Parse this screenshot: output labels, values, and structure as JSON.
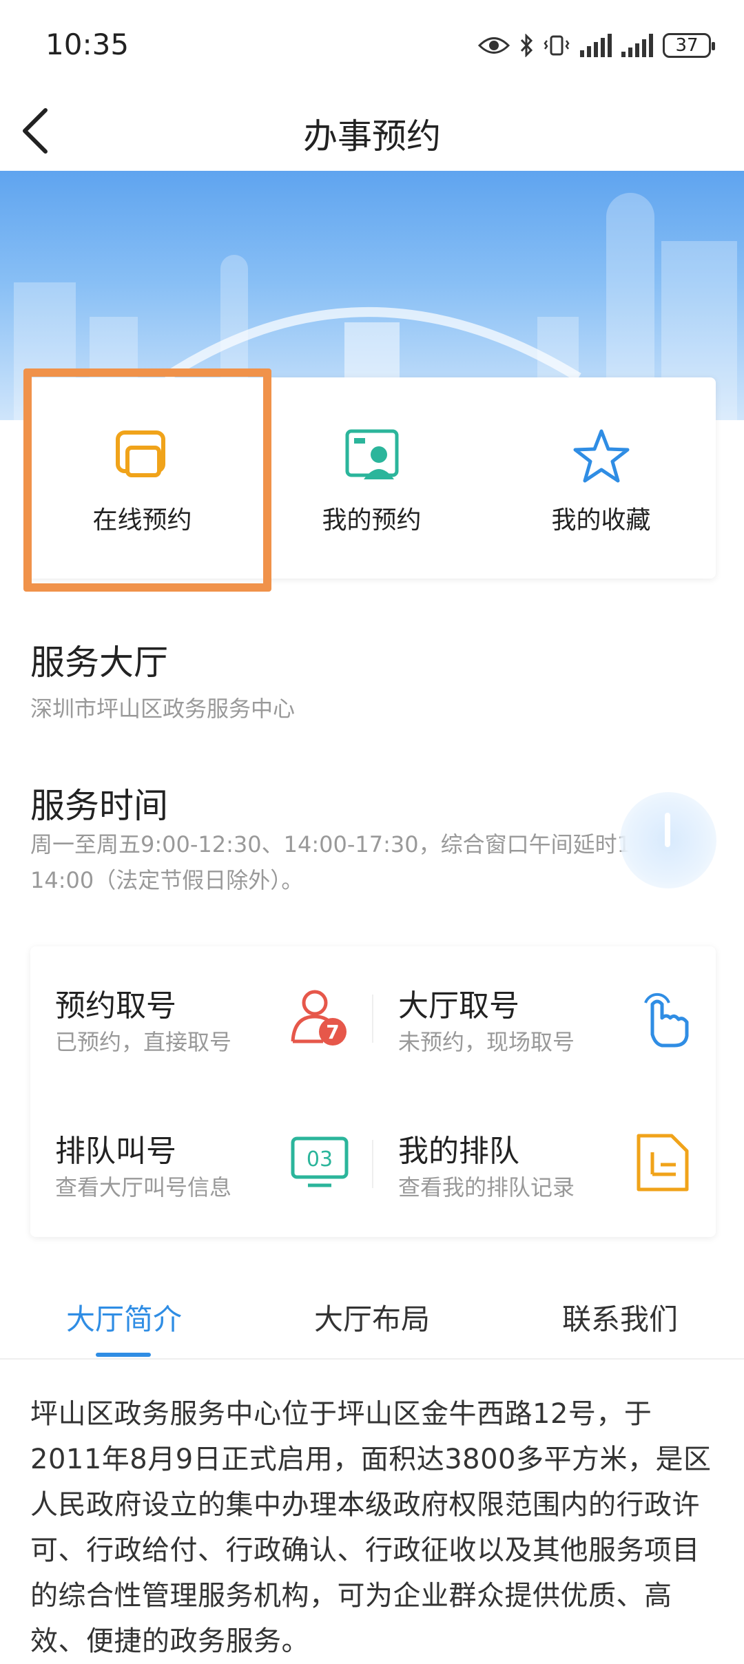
{
  "status_bar": {
    "time": "10:35",
    "battery": "37"
  },
  "nav": {
    "title": "办事预约"
  },
  "quick_menu": [
    {
      "label": "在线预约",
      "icon": "online-booking-icon",
      "color": "#f0a31a"
    },
    {
      "label": "我的预约",
      "icon": "my-booking-icon",
      "color": "#2bb59b"
    },
    {
      "label": "我的收藏",
      "icon": "star-icon",
      "color": "#2f8de4"
    }
  ],
  "hall": {
    "title": "服务大厅",
    "name": "深圳市坪山区政务服务中心"
  },
  "hours": {
    "title": "服务时间",
    "text": "周一至周五9:00-12:30、14:00-17:30，综合窗口午间延时12:30-14:00（法定节假日除外）。"
  },
  "queue": [
    {
      "title": "预约取号",
      "sub": "已预约，直接取号",
      "icon": "person-seven-icon",
      "icon_text": "7",
      "color": "#e6574a"
    },
    {
      "title": "大厅取号",
      "sub": "未预约，现场取号",
      "icon": "tap-hand-icon",
      "color": "#2f8de4"
    },
    {
      "title": "排队叫号",
      "sub": "查看大厅叫号信息",
      "icon": "monitor-number-icon",
      "icon_text": "03",
      "color": "#2bb59b"
    },
    {
      "title": "我的排队",
      "sub": "查看我的排队记录",
      "icon": "document-icon",
      "color": "#f0a31a"
    }
  ],
  "tabs": [
    {
      "label": "大厅简介",
      "active": true
    },
    {
      "label": "大厅布局",
      "active": false
    },
    {
      "label": "联系我们",
      "active": false
    }
  ],
  "intro_text": "坪山区政务服务中心位于坪山区金牛西路12号，于2011年8月9日正式启用，面积达3800多平方米，是区人民政府设立的集中办理本级政府权限范围内的行政许可、行政给付、行政确认、行政征收以及其他服务项目的综合性管理服务机构，可为企业群众提供优质、高效、便捷的政务服务。",
  "colors": {
    "accent": "#2f8de4",
    "highlight": "#f0924a"
  }
}
